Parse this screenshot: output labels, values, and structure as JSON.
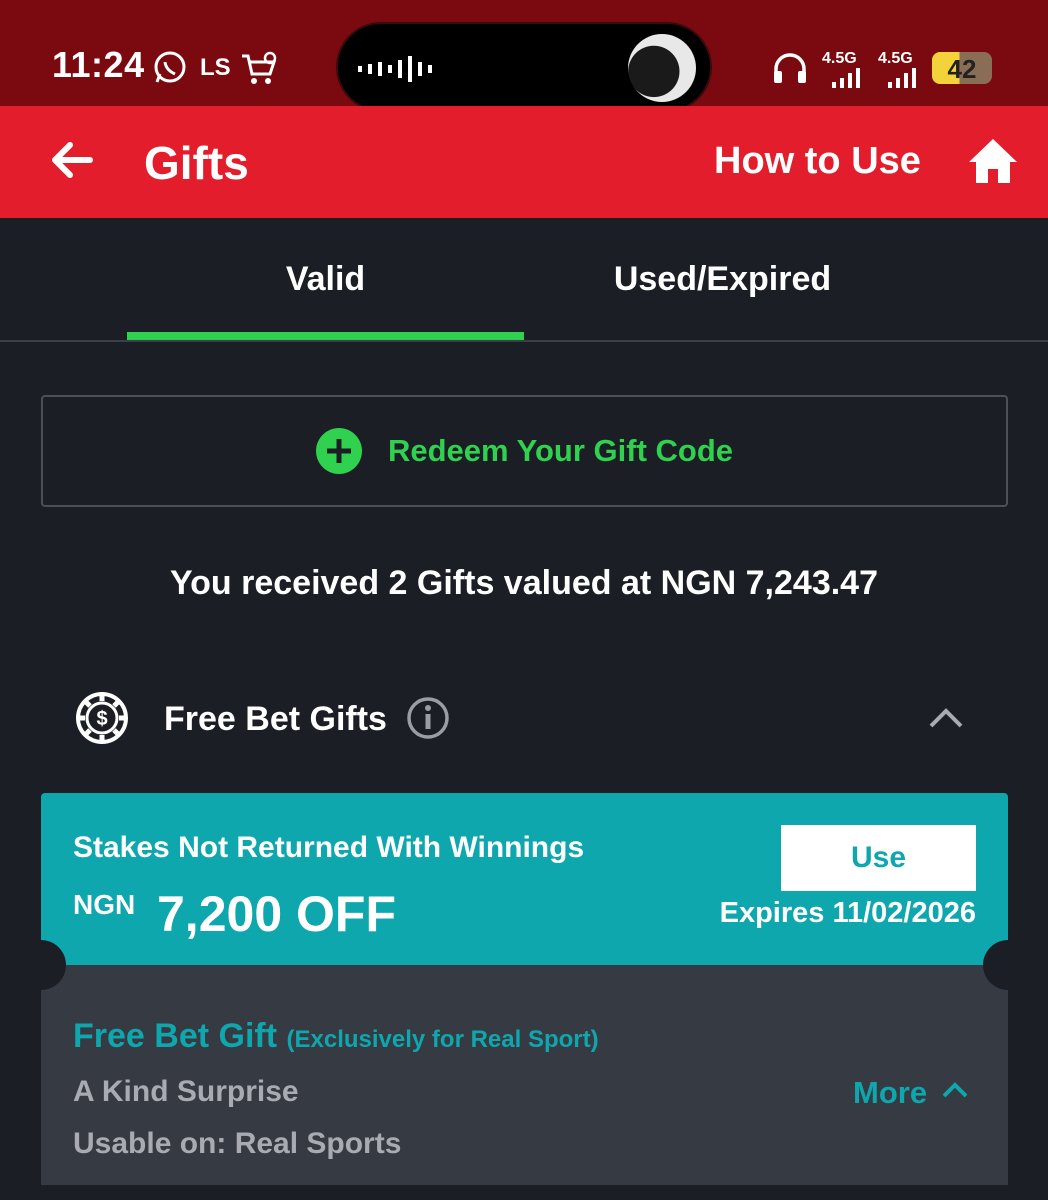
{
  "status_bar": {
    "time": "11:24",
    "carrier_badge": "LS",
    "network_1": "4.5G",
    "network_2": "4.5G",
    "battery_level": "42",
    "battery_color": "#f3d23a"
  },
  "app_bar": {
    "title": "Gifts",
    "help_link": "How to Use",
    "background": "#e31d2b"
  },
  "tabs": [
    {
      "label": "Valid",
      "active": true
    },
    {
      "label": "Used/Expired",
      "active": false
    }
  ],
  "redeem": {
    "label": "Redeem Your Gift Code",
    "accent": "#2fd14f"
  },
  "summary": "You received 2 Gifts valued at NGN 7,243.47",
  "section": {
    "title": "Free Bet Gifts",
    "icons": [
      "chip-icon",
      "info-icon",
      "chevron-up-icon"
    ]
  },
  "gift_card": {
    "condition": "Stakes Not Returned With Winnings",
    "currency": "NGN",
    "amount": "7,200 OFF",
    "use_label": "Use",
    "expires": "Expires 11/02/2026",
    "type": "Free Bet Gift",
    "type_note": "(Exclusively for Real Sport)",
    "description": "A Kind Surprise",
    "usable_on": "Usable on: Real Sports",
    "more_label": "More",
    "accent": "#0ea7ad"
  }
}
